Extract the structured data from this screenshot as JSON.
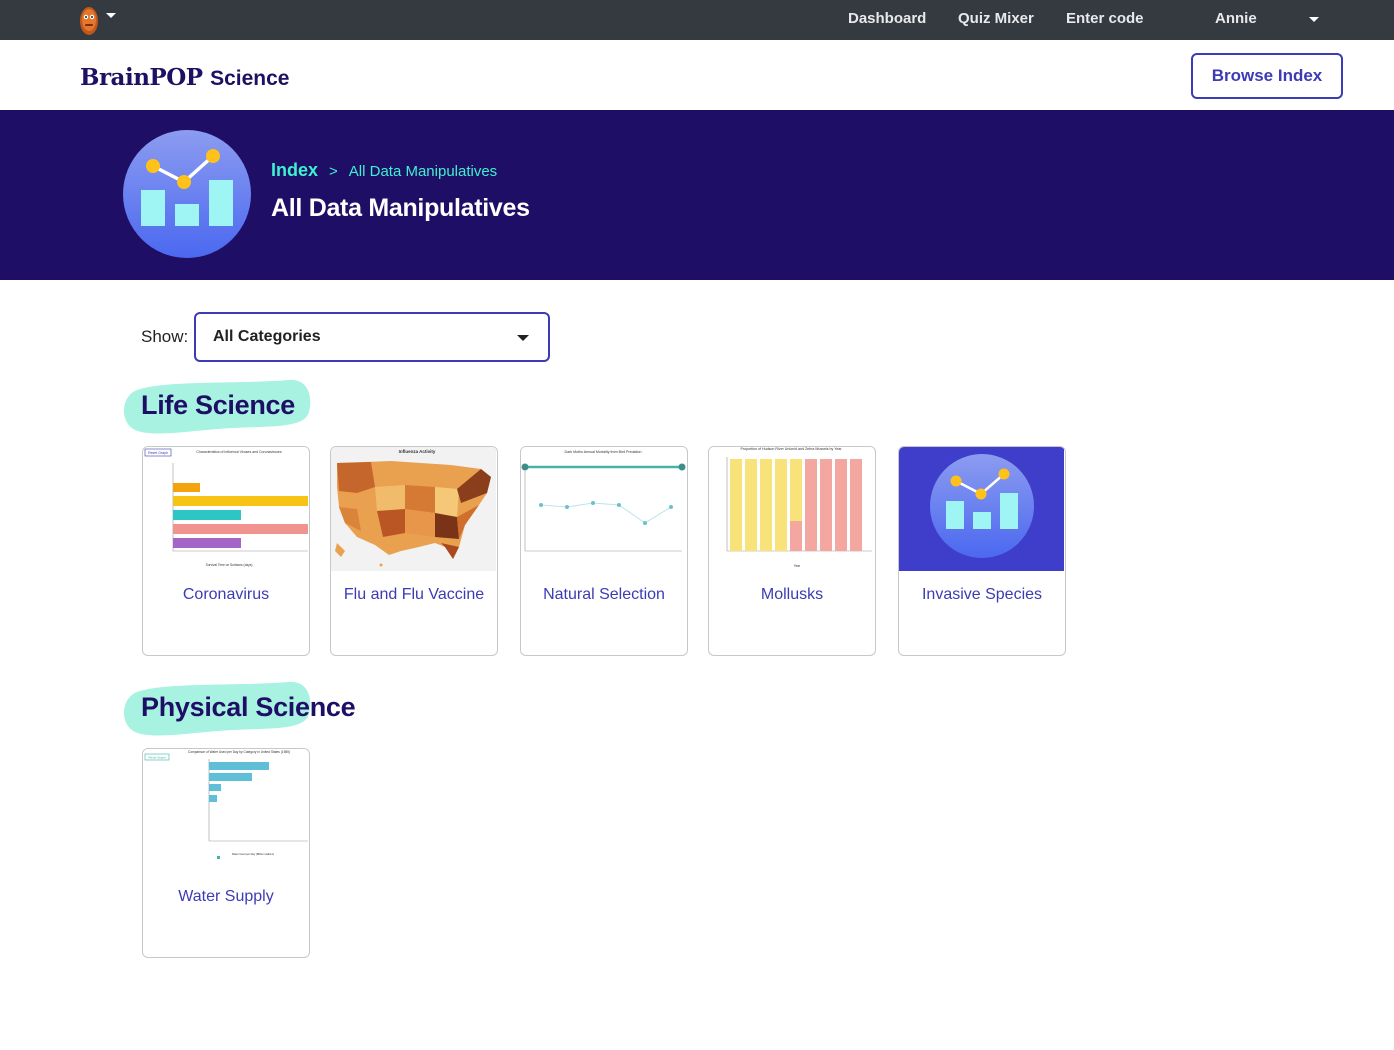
{
  "topbar": {
    "nav": [
      "Dashboard",
      "Quiz Mixer",
      "Enter code"
    ],
    "user": "Annie"
  },
  "header": {
    "logo_main": "BrainPOP",
    "logo_sub": "Science",
    "browse_label": "Browse Index"
  },
  "banner": {
    "crumb_index": "Index",
    "crumb_sep": ">",
    "crumb_current": "All Data Manipulatives",
    "title": "All Data Manipulatives"
  },
  "filter": {
    "label": "Show:",
    "selected": "All Categories"
  },
  "sections": [
    {
      "title": "Life Science",
      "cards": [
        {
          "label": "Coronavirus",
          "thumb_title": "Characteristics of Influenza Viruses and Coronaviruses",
          "thumb_button": "Reset Graph",
          "thumb_axis": "Survival Time on Surfaces (days)"
        },
        {
          "label": "Flu and Flu Vaccine",
          "thumb_title": "Influenza Activity"
        },
        {
          "label": "Natural Selection",
          "thumb_title": "Dark Moths Annual Mortality from Bird Predation"
        },
        {
          "label": "Mollusks",
          "thumb_title": "Proportion of Hudson River Unionid and Zebra Mussels by Year",
          "thumb_axis": "Year"
        },
        {
          "label": "Invasive Species"
        }
      ]
    },
    {
      "title": "Physical Science",
      "cards": [
        {
          "label": "Water Supply",
          "thumb_title": "Comparison of Water Used per Day by Category in United States (1985)",
          "thumb_button": "Reset Graph",
          "thumb_axis": "Water Used per Day (Billion Gallons)"
        }
      ]
    }
  ],
  "colors": {
    "topbar": "#353a40",
    "banner": "#1f0e66",
    "accent": "#3d3bb4",
    "mint": "#3ff0cf",
    "blob": "#a8f2e1"
  }
}
